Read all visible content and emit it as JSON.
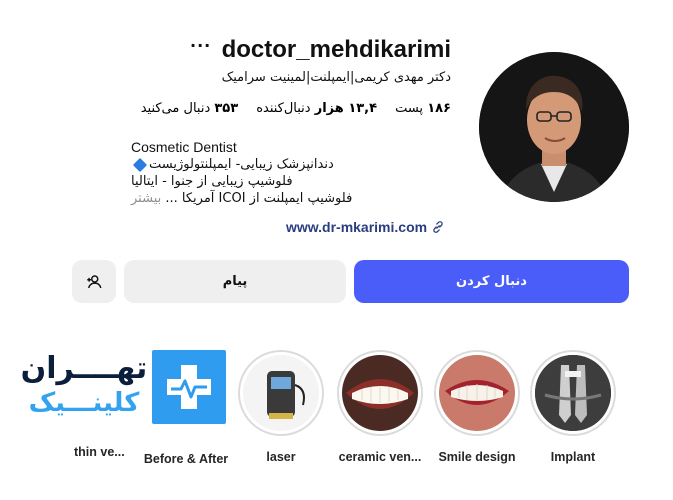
{
  "profile": {
    "username": "doctor_mehdikarimi",
    "more_icon": "···",
    "full_name": "دکتر مهدی کریمی|ایمپلنت|لمینیت سرامیک",
    "stats": {
      "posts_value": "۱۸۶",
      "posts_label": "پست",
      "followers_value": "۱۳,۴ هزار",
      "followers_label": "دنبال‌کننده",
      "following_value": "۳۵۳",
      "following_label": "دنبال می‌کنید"
    },
    "bio": {
      "line1": "Cosmetic Dentist",
      "line2": "دندانپزشک زیبایی- ایمپلنتولوژیست",
      "line3": "فلوشیپ زیبایی از جنوا - ایتالیا",
      "line4": "فلوشیپ ایمپلنت از ICOI آمریکا ...",
      "more": "بیشتر"
    },
    "website": "www.dr-mkarimi.com"
  },
  "actions": {
    "follow": "دنبال کردن",
    "message": "پیام"
  },
  "highlights": [
    {
      "label": "Implant"
    },
    {
      "label": "Smile design"
    },
    {
      "label": "ceramic ven..."
    },
    {
      "label": "laser"
    },
    {
      "label": "Before & After"
    },
    {
      "label": "thin ve..."
    }
  ],
  "clinic_logo": {
    "line1": "تهــــران",
    "line2": "کلینـــیک"
  },
  "colors": {
    "follow_button": "#4a5df9",
    "secondary_button": "#efefef",
    "link": "#2a3d7f",
    "clinic_blue": "#2f9cf0",
    "clinic_dark": "#0b1e3b"
  }
}
